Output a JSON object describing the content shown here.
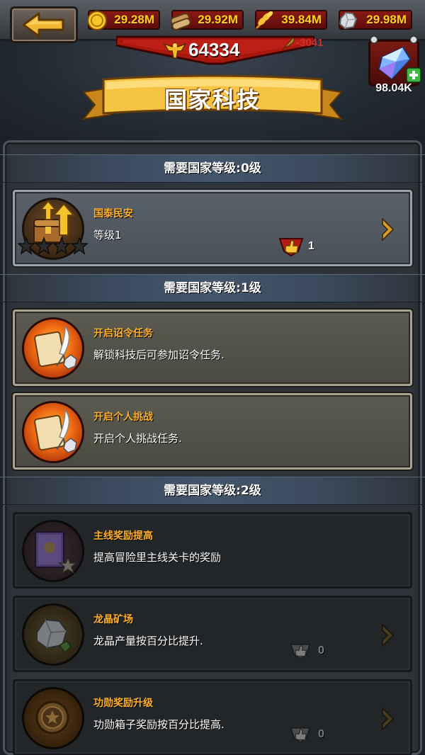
{
  "resources": [
    {
      "icon": "gold-coin-icon",
      "value": "29.28M"
    },
    {
      "icon": "wood-log-icon",
      "value": "29.92M"
    },
    {
      "icon": "wheat-icon",
      "value": "39.84M"
    },
    {
      "icon": "stone-icon",
      "value": "29.98M"
    }
  ],
  "power": {
    "value": "64334",
    "delta": "-3041"
  },
  "crystal": {
    "value": "98.04K"
  },
  "title": "国家科技",
  "sections": [
    {
      "heading": "需要国家等级:0级"
    },
    {
      "heading": "需要国家等级:1级"
    },
    {
      "heading": "需要国家等级:2级"
    }
  ],
  "techs": [
    {
      "name": "国泰民安",
      "desc": "等级1",
      "cost": "1",
      "state": "active",
      "stars_total": 4,
      "stars_filled": 0,
      "icon": "treasure-chest-arrows-icon"
    },
    {
      "name": "开启诏令任务",
      "desc": "解锁科技后可参加诏令任务.",
      "state": "unlocked",
      "icon": "scroll-quill-icon"
    },
    {
      "name": "开启个人挑战",
      "desc": "开启个人挑战任务.",
      "state": "unlocked",
      "icon": "scroll-quill-icon"
    },
    {
      "name": "主线奖励提高",
      "desc": "提高冒险里主线关卡的奖励",
      "state": "locked",
      "icon": "book-star-icon"
    },
    {
      "name": "龙晶矿场",
      "desc": "龙晶产量按百分比提升.",
      "cost": "0",
      "state": "locked",
      "icon": "ore-rock-icon"
    },
    {
      "name": "功勋奖励升级",
      "desc": "功勋箱子奖励按百分比提高.",
      "cost": "0",
      "state": "locked",
      "icon": "medal-star-icon"
    }
  ],
  "colors": {
    "accent": "#ffb02a",
    "gold_text": "#ffd21a",
    "banner_red": "#8a1a14"
  }
}
